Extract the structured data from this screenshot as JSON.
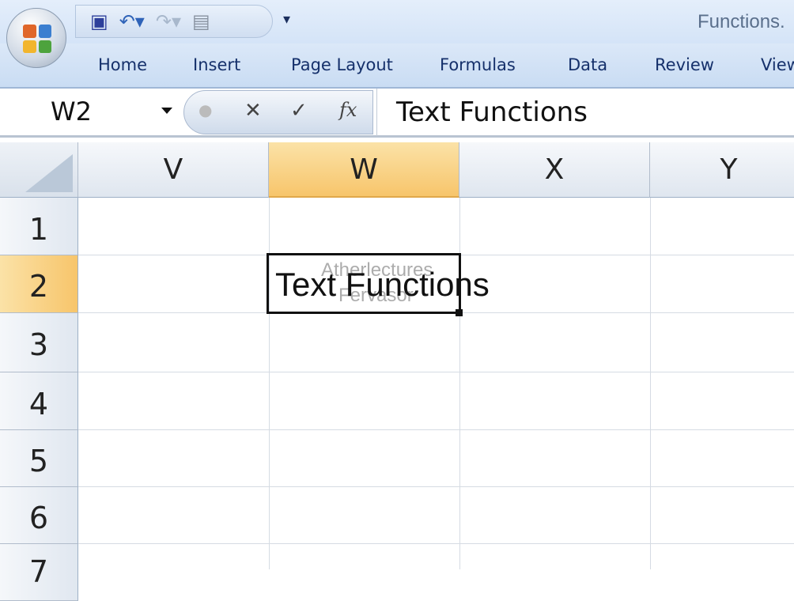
{
  "window": {
    "title": "Functions."
  },
  "quick_access": {
    "save": "save-icon",
    "undo": "undo-icon",
    "redo": "redo-icon",
    "form": "form-icon",
    "customize": "customize-icon"
  },
  "ribbon": {
    "tabs": [
      "Home",
      "Insert",
      "Page Layout",
      "Formulas",
      "Data",
      "Review",
      "View"
    ]
  },
  "formula_bar": {
    "name_box": "W2",
    "cancel": "✕",
    "enter": "✓",
    "fx": "fx",
    "content": "Text Functions"
  },
  "sheet": {
    "columns": [
      "V",
      "W",
      "X",
      "Y"
    ],
    "rows": [
      "1",
      "2",
      "3",
      "4",
      "5",
      "6",
      "7"
    ],
    "selected_column": "W",
    "selected_row": "2",
    "cells": {
      "W2": "Text Functions"
    }
  },
  "watermark": [
    "Atherlectures",
    "Fervasor"
  ],
  "colors": {
    "accent": "#f7c56b",
    "ribbon": "#c9dcf3"
  }
}
